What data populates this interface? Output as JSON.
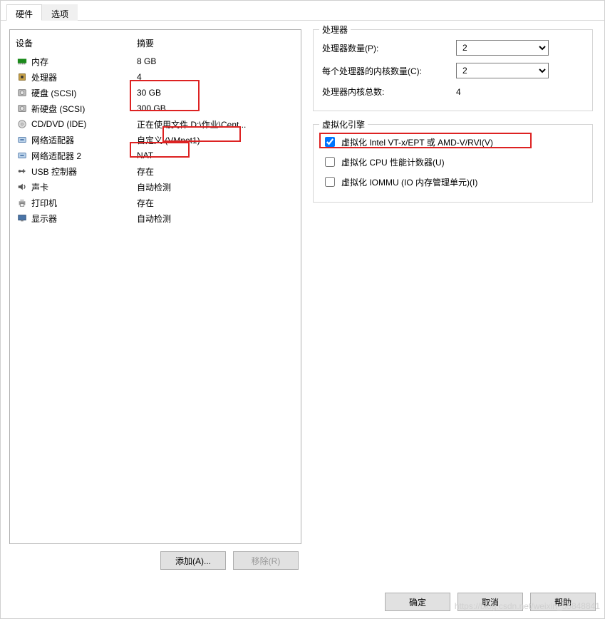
{
  "tabs": {
    "hardware": "硬件",
    "options": "选项"
  },
  "device_header": {
    "name": "设备",
    "summary": "摘要"
  },
  "devices": [
    {
      "icon": "memory",
      "name": "内存",
      "summary": "8 GB"
    },
    {
      "icon": "cpu",
      "name": "处理器",
      "summary": "4"
    },
    {
      "icon": "disk",
      "name": "硬盘 (SCSI)",
      "summary": "30 GB"
    },
    {
      "icon": "disk",
      "name": "新硬盘 (SCSI)",
      "summary": "300 GB"
    },
    {
      "icon": "cd",
      "name": "CD/DVD (IDE)",
      "summary": "正在使用文件 D:\\作业\\Cent..."
    },
    {
      "icon": "net",
      "name": "网络适配器",
      "summary": "自定义 (VMnet1)"
    },
    {
      "icon": "net",
      "name": "网络适配器 2",
      "summary": "NAT"
    },
    {
      "icon": "usb",
      "name": "USB 控制器",
      "summary": "存在"
    },
    {
      "icon": "sound",
      "name": "声卡",
      "summary": "自动检测"
    },
    {
      "icon": "printer",
      "name": "打印机",
      "summary": "存在"
    },
    {
      "icon": "display",
      "name": "显示器",
      "summary": "自动检测"
    }
  ],
  "left_buttons": {
    "add": "添加(A)...",
    "remove": "移除(R)"
  },
  "processors": {
    "group_title": "处理器",
    "count_label": "处理器数量(P):",
    "count_value": "2",
    "cores_label": "每个处理器的内核数量(C):",
    "cores_value": "2",
    "total_label": "处理器内核总数:",
    "total_value": "4"
  },
  "virt": {
    "group_title": "虚拟化引擎",
    "vtx_label": "虚拟化 Intel VT-x/EPT 或 AMD-V/RVI(V)",
    "vtx_checked": true,
    "cpuperf_label": "虚拟化 CPU 性能计数器(U)",
    "cpuperf_checked": false,
    "iommu_label": "虚拟化 IOMMU (IO 内存管理单元)(I)",
    "iommu_checked": false
  },
  "footer": {
    "ok": "确定",
    "cancel": "取消",
    "help": "帮助"
  },
  "watermark": "https://blog.csdn.net/weixin_55848841"
}
